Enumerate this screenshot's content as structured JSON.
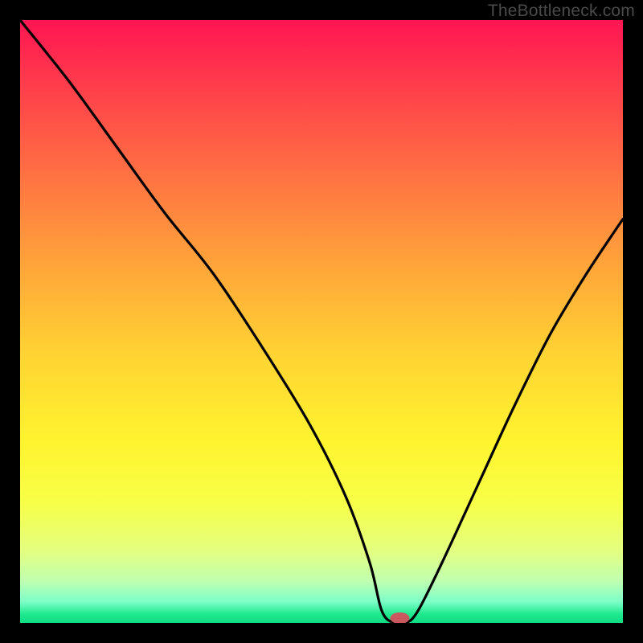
{
  "watermark": "TheBottleneck.com",
  "chart_data": {
    "type": "line",
    "title": "",
    "xlabel": "",
    "ylabel": "",
    "xlim": [
      0,
      100
    ],
    "ylim": [
      0,
      100
    ],
    "grid": false,
    "legend": false,
    "series": [
      {
        "name": "bottleneck-curve",
        "x": [
          0,
          8,
          16,
          24,
          32,
          40,
          48,
          54,
          58,
          60,
          62,
          64,
          66,
          70,
          76,
          82,
          88,
          94,
          100
        ],
        "y": [
          100,
          90,
          79,
          68,
          58,
          46,
          33,
          21,
          10,
          2,
          0,
          0,
          2,
          10,
          23,
          36,
          48,
          58,
          67
        ]
      }
    ],
    "marker": {
      "x": 63,
      "y": 0.8,
      "color": "#c9595e",
      "rx": 12,
      "ry": 7
    },
    "gradient_stops": [
      {
        "offset": 0.0,
        "color": "#ff1552"
      },
      {
        "offset": 0.1,
        "color": "#ff3a4c"
      },
      {
        "offset": 0.25,
        "color": "#ff6f43"
      },
      {
        "offset": 0.4,
        "color": "#ffa23a"
      },
      {
        "offset": 0.55,
        "color": "#ffd233"
      },
      {
        "offset": 0.7,
        "color": "#fff42f"
      },
      {
        "offset": 0.8,
        "color": "#f7ff47"
      },
      {
        "offset": 0.88,
        "color": "#e4ff80"
      },
      {
        "offset": 0.93,
        "color": "#c0ffb0"
      },
      {
        "offset": 0.965,
        "color": "#7dffc8"
      },
      {
        "offset": 0.985,
        "color": "#21e98f"
      },
      {
        "offset": 1.0,
        "color": "#0edc84"
      }
    ]
  }
}
